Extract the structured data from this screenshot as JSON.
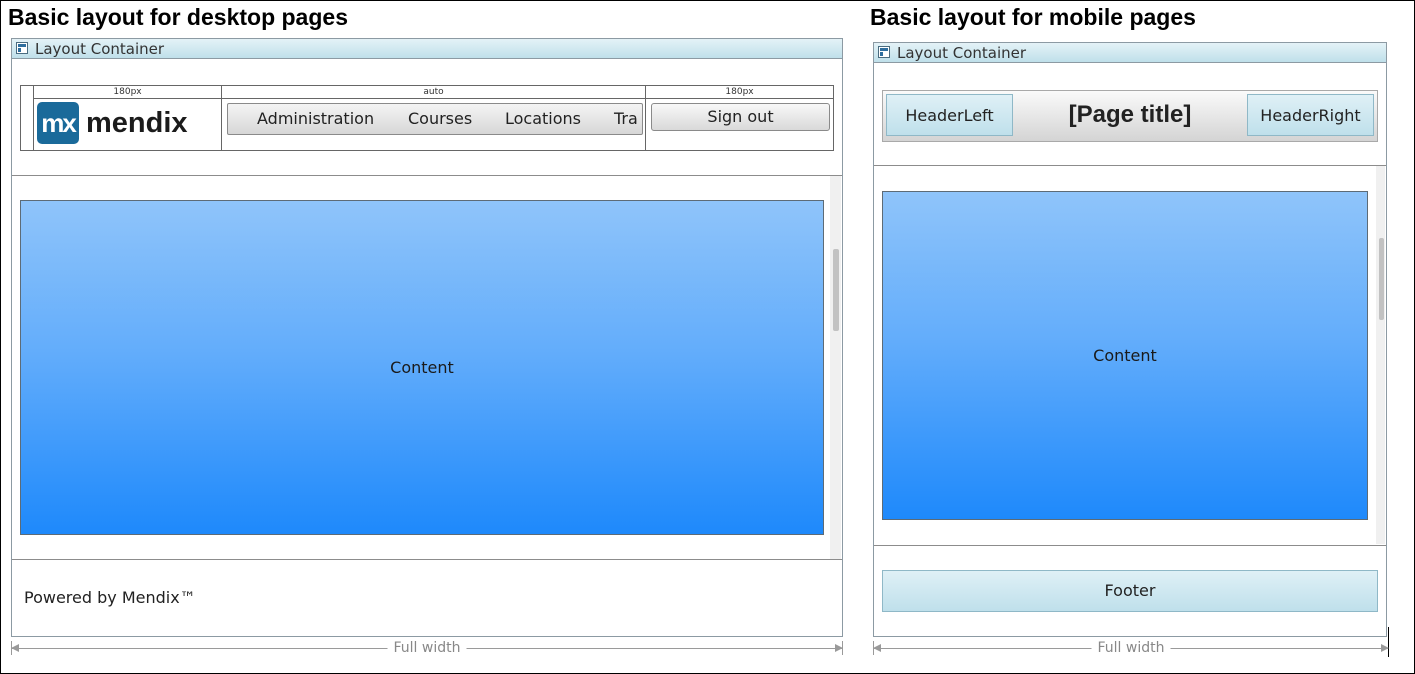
{
  "desktop": {
    "heading": "Basic layout for desktop pages",
    "container_title": "Layout Container",
    "header_columns": [
      "180px",
      "auto",
      "180px"
    ],
    "logo": {
      "badge": "mx",
      "word": "mendix",
      "brand_color": "#1a6a9a"
    },
    "menu_items": [
      "Administration",
      "Courses",
      "Locations",
      "Tra"
    ],
    "signout_label": "Sign out",
    "content_label": "Content",
    "footer_text": "Powered by Mendix™",
    "dimension_label": "Full width"
  },
  "mobile": {
    "heading": "Basic layout for mobile pages",
    "container_title": "Layout Container",
    "header_left": "HeaderLeft",
    "page_title": "[Page title]",
    "header_right": "HeaderRight",
    "content_label": "Content",
    "footer_label": "Footer",
    "dimension_label": "Full width"
  },
  "colors": {
    "content_top": "#8fc4fa",
    "content_bottom": "#1e89fb",
    "title_bar": "#bfe0ea"
  }
}
